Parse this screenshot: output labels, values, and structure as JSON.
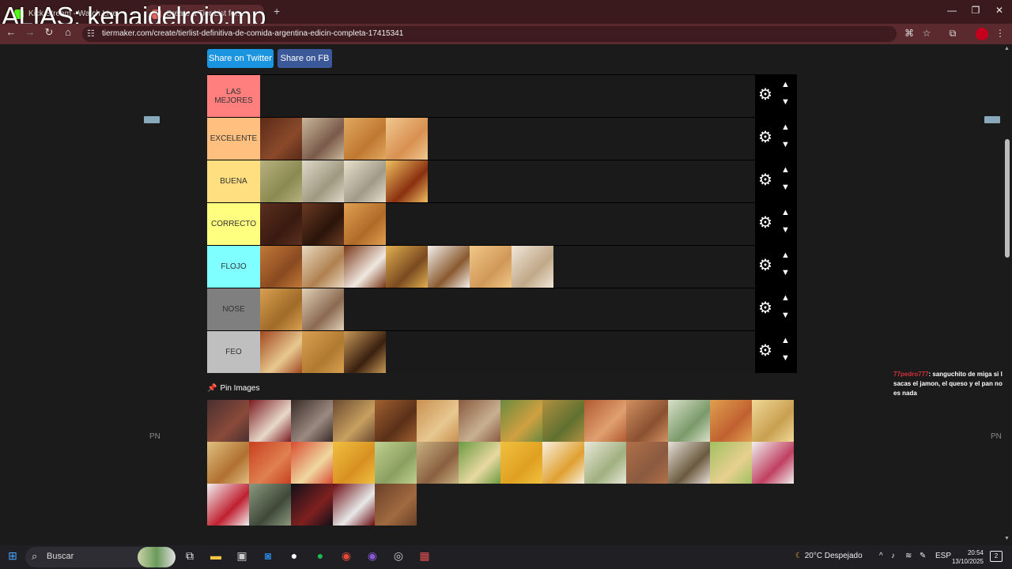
{
  "overlay": {
    "alias": "ALIAS: kenaidelrojo.mp"
  },
  "browser": {
    "tabs": [
      {
        "title": "Kick Stream - Watch Live",
        "favicon_color": "#53fc18"
      },
      {
        "title": "Create a Tier List for...",
        "favicon_color": "#e06666"
      }
    ],
    "url": "tiermaker.com/create/tierlist-definitiva-de-comida-argentina-edicin-completa-17415341"
  },
  "page": {
    "share_twitter": "Share on Twitter",
    "share_fb": "Share on FB",
    "pin_images_label": "Pin Images",
    "side_label_left": "PN",
    "side_label_right": "PN"
  },
  "tiers": [
    {
      "label": "LAS MEJORES",
      "color": "#ff7f7f",
      "items": []
    },
    {
      "label": "EXCELENTE",
      "color": "#ffbf7f",
      "items": [
        {
          "name": "brownie",
          "colors": [
            "#5a2a18",
            "#8a4a2a"
          ]
        },
        {
          "name": "alfajor-bowl",
          "colors": [
            "#c8b89a",
            "#7a5a4a"
          ]
        },
        {
          "name": "medialunas-basket",
          "colors": [
            "#e0a860",
            "#c07830"
          ]
        },
        {
          "name": "pasta-frola",
          "colors": [
            "#f0c890",
            "#d89050"
          ]
        }
      ]
    },
    {
      "label": "BUENA",
      "color": "#ffdf7f",
      "items": [
        {
          "name": "tamales",
          "colors": [
            "#b8b080",
            "#8a8a50"
          ]
        },
        {
          "name": "macarons",
          "colors": [
            "#ddd8c8",
            "#a09880"
          ]
        },
        {
          "name": "sandwich-de-miga",
          "colors": [
            "#e8e0cc",
            "#a09a88"
          ]
        },
        {
          "name": "flan",
          "colors": [
            "#f0c060",
            "#8a3010"
          ]
        }
      ]
    },
    {
      "label": "CORRECTO",
      "color": "#ffff7f",
      "items": [
        {
          "name": "chocolate-bar",
          "colors": [
            "#5a3020",
            "#3a1a10"
          ]
        },
        {
          "name": "bombon",
          "colors": [
            "#6a3a22",
            "#2a140a"
          ]
        },
        {
          "name": "trenza-bread",
          "colors": [
            "#e0a050",
            "#b06a28"
          ]
        }
      ]
    },
    {
      "label": "FLOJO",
      "color": "#7fffff",
      "items": [
        {
          "name": "churros",
          "colors": [
            "#c07838",
            "#8a4a20"
          ]
        },
        {
          "name": "pan-relleno",
          "colors": [
            "#e8d8c0",
            "#b08050"
          ]
        },
        {
          "name": "bolitas-fritas",
          "colors": [
            "#7a3818",
            "#f0e8e0"
          ]
        },
        {
          "name": "panqueques",
          "colors": [
            "#e0b050",
            "#7a4a20"
          ]
        },
        {
          "name": "torta-merengue",
          "colors": [
            "#f4f0ec",
            "#8a5a30"
          ]
        },
        {
          "name": "tortas-fritas",
          "colors": [
            "#f0c888",
            "#d09858"
          ]
        },
        {
          "name": "arroz-con-leche",
          "colors": [
            "#f0e6d8",
            "#c0a888"
          ]
        }
      ]
    },
    {
      "label": "NOSE",
      "color": "#7f7f7f",
      "items": [
        {
          "name": "empanadas",
          "colors": [
            "#d8a050",
            "#a06a28"
          ]
        },
        {
          "name": "guiso-avena",
          "colors": [
            "#e0d0b8",
            "#8a6a50"
          ]
        }
      ]
    },
    {
      "label": "FEO",
      "color": "#bfbfbf",
      "items": [
        {
          "name": "tarta-de-membrillo",
          "colors": [
            "#a04820",
            "#e8c890"
          ]
        },
        {
          "name": "pastelitos",
          "colors": [
            "#d8a050",
            "#b07a30"
          ]
        },
        {
          "name": "postre-chocotorta",
          "colors": [
            "#c89858",
            "#3a2010"
          ]
        }
      ]
    }
  ],
  "pool": [
    {
      "name": "asado",
      "colors": [
        "#4a3030",
        "#8a4a3a"
      ]
    },
    {
      "name": "torta-frutos-rojos",
      "colors": [
        "#7a1a20",
        "#e8d8c8"
      ]
    },
    {
      "name": "morcilla",
      "colors": [
        "#3a2a28",
        "#9a8a80"
      ]
    },
    {
      "name": "provoleta",
      "colors": [
        "#6a4a30",
        "#c8a060"
      ]
    },
    {
      "name": "pollo-asado",
      "colors": [
        "#a06030",
        "#5a3018"
      ]
    },
    {
      "name": "milanesa",
      "colors": [
        "#c89050",
        "#e8c890"
      ]
    },
    {
      "name": "picada",
      "colors": [
        "#8a5a40",
        "#c8b090"
      ]
    },
    {
      "name": "locro",
      "colors": [
        "#6a8a40",
        "#d0a040"
      ]
    },
    {
      "name": "sopa",
      "colors": [
        "#b09040",
        "#607030"
      ]
    },
    {
      "name": "cazuela",
      "colors": [
        "#b05a30",
        "#e0a070"
      ]
    },
    {
      "name": "choripan",
      "colors": [
        "#d09060",
        "#8a5030"
      ]
    },
    {
      "name": "humita",
      "colors": [
        "#d8e0c8",
        "#7a9a6a"
      ]
    },
    {
      "name": "pizza",
      "colors": [
        "#e0a050",
        "#c06030"
      ]
    },
    {
      "name": "fugazzeta",
      "colors": [
        "#f0d898",
        "#c8a050"
      ]
    },
    {
      "name": "ravioles",
      "colors": [
        "#e0c080",
        "#b07030"
      ]
    },
    {
      "name": "fideos-tuco",
      "colors": [
        "#c84020",
        "#e08050"
      ]
    },
    {
      "name": "pizza-muzza",
      "colors": [
        "#d84a30",
        "#f0d8a0"
      ]
    },
    {
      "name": "tortilla",
      "colors": [
        "#f0c040",
        "#d89020"
      ]
    },
    {
      "name": "chipa",
      "colors": [
        "#c0d090",
        "#8aa060"
      ]
    },
    {
      "name": "lasagna",
      "colors": [
        "#c8b080",
        "#8a6040"
      ]
    },
    {
      "name": "ensalada",
      "colors": [
        "#6a9a40",
        "#e8d8a0"
      ]
    },
    {
      "name": "papas-fritas",
      "colors": [
        "#f0c040",
        "#e0a020"
      ]
    },
    {
      "name": "huevos-rellenos",
      "colors": [
        "#f8f0e0",
        "#e0a030"
      ]
    },
    {
      "name": "ensalada-rusa",
      "colors": [
        "#e8e8d8",
        "#a0b080"
      ]
    },
    {
      "name": "salchichas",
      "colors": [
        "#b07048",
        "#8a5a40"
      ]
    },
    {
      "name": "matambre",
      "colors": [
        "#e8e0d8",
        "#6a5a40"
      ]
    },
    {
      "name": "pascualina",
      "colors": [
        "#a0c060",
        "#e8d090"
      ]
    },
    {
      "name": "vitel-tone",
      "colors": [
        "#f0f0f0",
        "#c04060"
      ]
    },
    {
      "name": "manteca",
      "colors": [
        "#f0f0f0",
        "#c02030"
      ]
    },
    {
      "name": "mate-cocido",
      "colors": [
        "#8a9a80",
        "#404838"
      ]
    },
    {
      "name": "fernet",
      "colors": [
        "#101018",
        "#802020"
      ]
    },
    {
      "name": "vino-tinto",
      "colors": [
        "#6a0a10",
        "#e8e8e8"
      ]
    },
    {
      "name": "dulce-de-leche",
      "colors": [
        "#6a4028",
        "#a06a40"
      ]
    }
  ],
  "chat": {
    "user": "77pedro777",
    "message": ": sanguchito de miga si le sacas el jamon, el queso y el pan no es nada"
  },
  "taskbar": {
    "search_placeholder": "Buscar",
    "weather": "20°C  Despejado",
    "lang": "ESP",
    "time": "20:54",
    "date": "13/10/2025",
    "notifications": "2"
  }
}
